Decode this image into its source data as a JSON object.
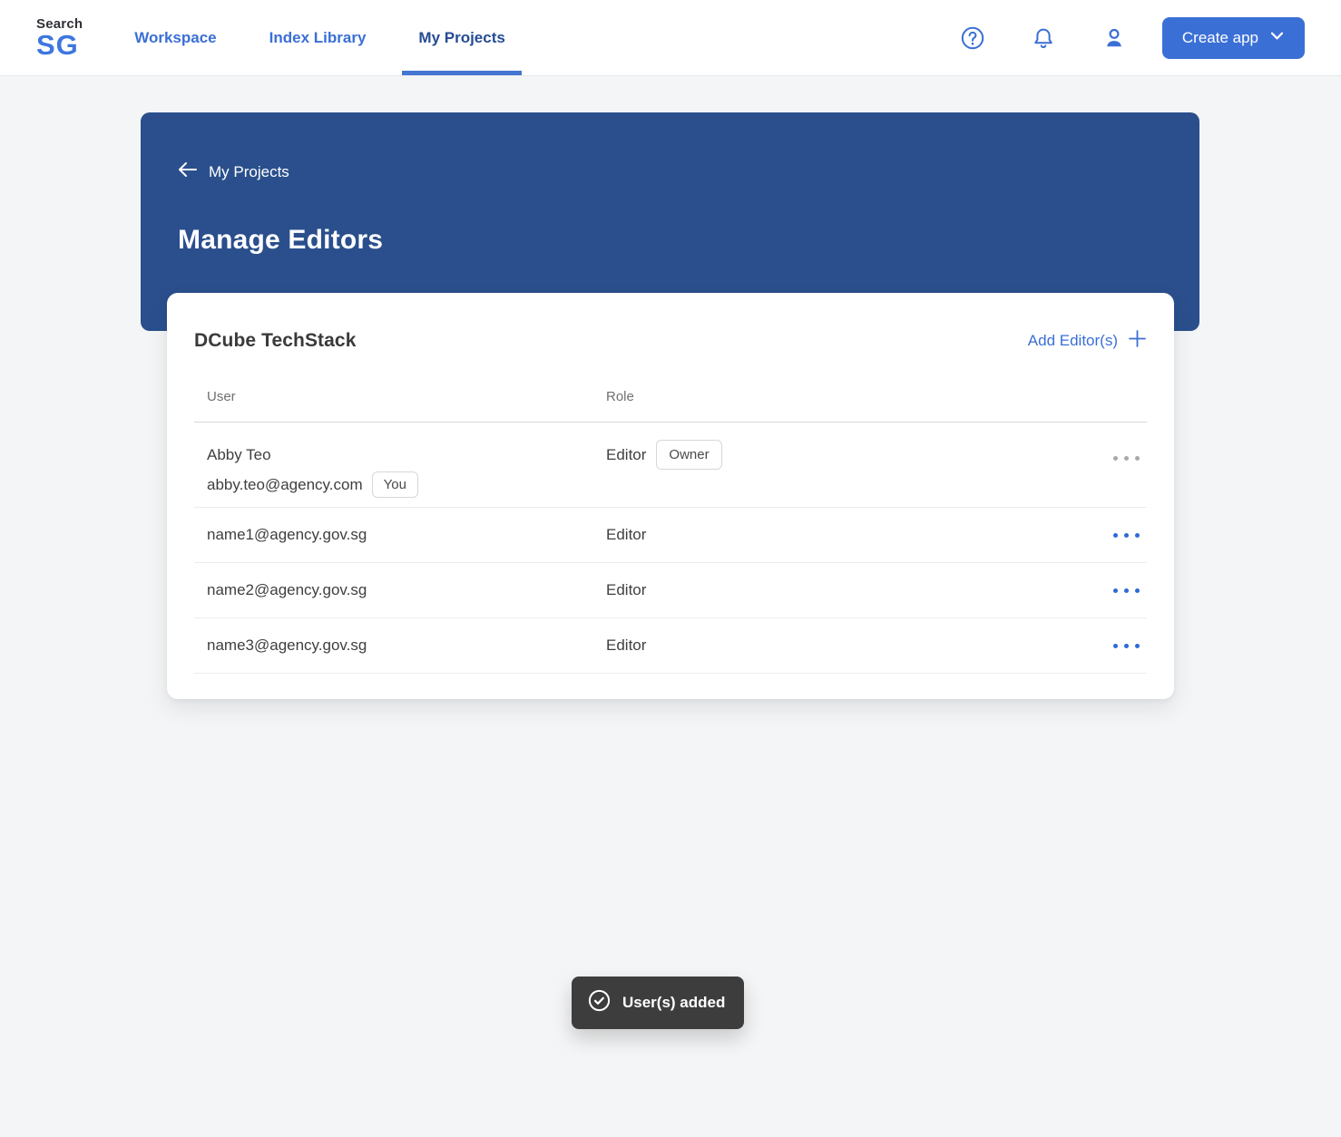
{
  "brand": {
    "line1": "Search",
    "line2": "SG"
  },
  "nav": {
    "items": [
      {
        "label": "Workspace",
        "active": false
      },
      {
        "label": "Index Library",
        "active": false
      },
      {
        "label": "My Projects",
        "active": true
      }
    ]
  },
  "topbar": {
    "create_app_label": "Create app"
  },
  "hero": {
    "breadcrumb": "My Projects",
    "title": "Manage Editors"
  },
  "card": {
    "title": "DCube TechStack",
    "add_editors_label": "Add Editor(s)",
    "columns": {
      "user": "User",
      "role": "Role"
    },
    "rows": [
      {
        "name": "Abby Teo",
        "email": "abby.teo@agency.com",
        "you_badge": "You",
        "role": "Editor",
        "role_badge": "Owner"
      },
      {
        "email": "name1@agency.gov.sg",
        "role": "Editor"
      },
      {
        "email": "name2@agency.gov.sg",
        "role": "Editor"
      },
      {
        "email": "name3@agency.gov.sg",
        "role": "Editor"
      }
    ]
  },
  "toast": {
    "message": "User(s) added"
  },
  "colors": {
    "accent_blue": "#3a6fd6",
    "logo_blue": "#3d77de",
    "nav_active": "#254c93",
    "hero_bg": "#2a4f8c",
    "toast_bg": "#3d3d3d",
    "page_bg": "#f4f5f6"
  }
}
